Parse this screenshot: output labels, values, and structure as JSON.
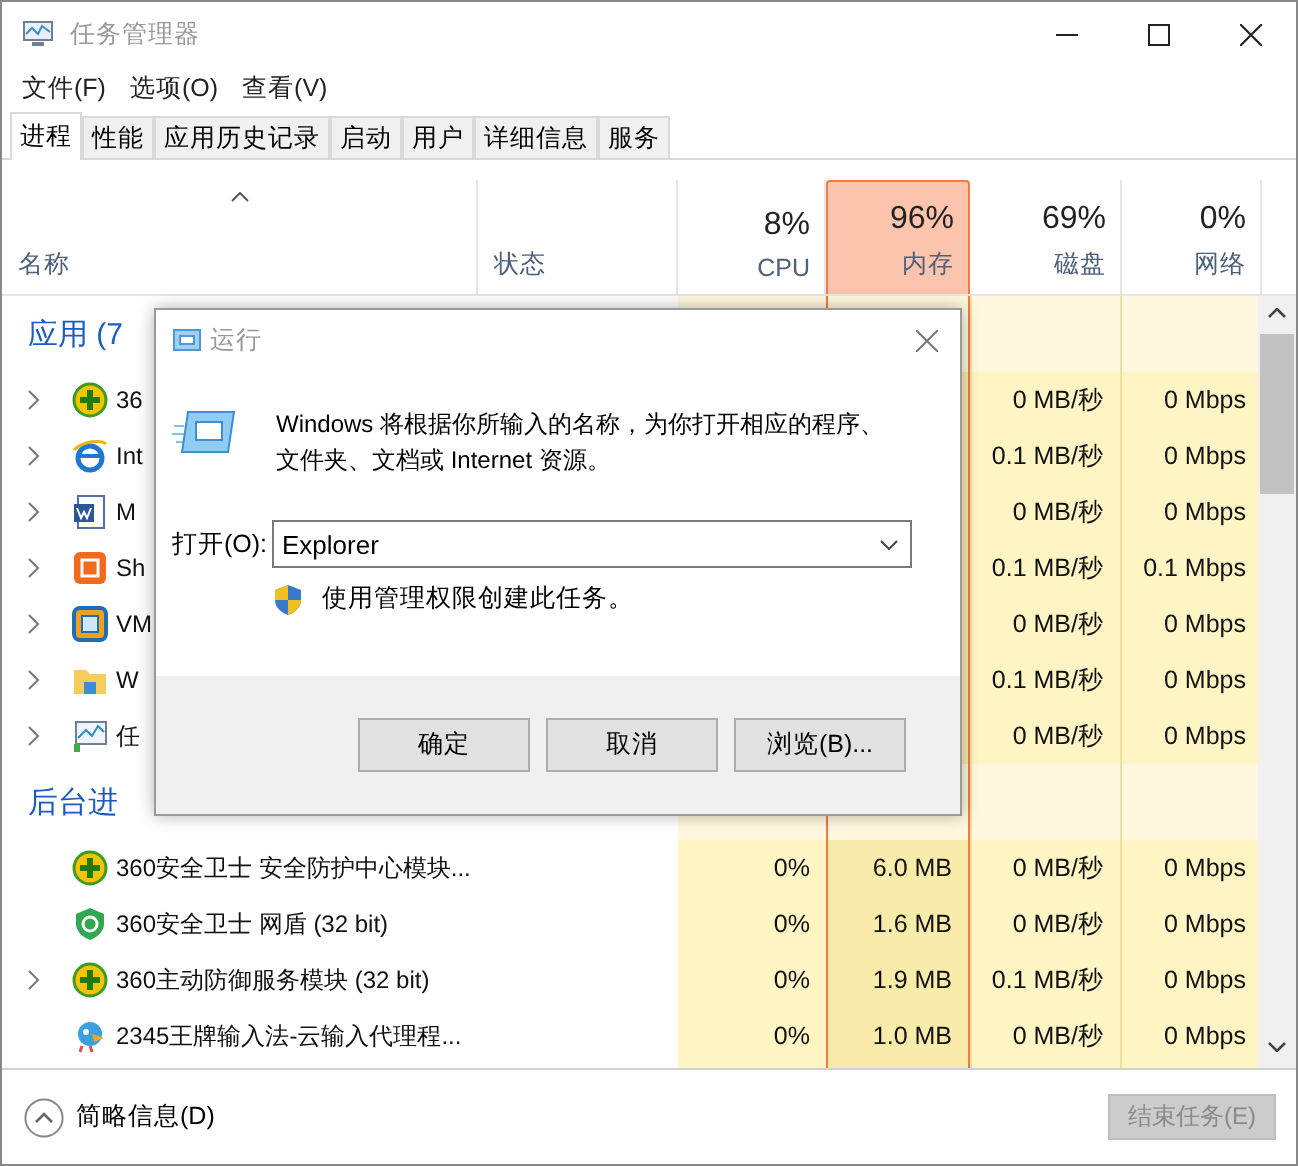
{
  "window": {
    "title": "任务管理器"
  },
  "menu": [
    "文件(F)",
    "选项(O)",
    "查看(V)"
  ],
  "tabs": [
    {
      "label": "进程",
      "selected": true
    },
    {
      "label": "性能",
      "selected": false
    },
    {
      "label": "应用历史记录",
      "selected": false
    },
    {
      "label": "启动",
      "selected": false
    },
    {
      "label": "用户",
      "selected": false
    },
    {
      "label": "详细信息",
      "selected": false
    },
    {
      "label": "服务",
      "selected": false
    }
  ],
  "columns": [
    {
      "kind": "name",
      "label": "名称",
      "sorted": true,
      "highlighted": false
    },
    {
      "kind": "status",
      "label": "状态",
      "sorted": false,
      "highlighted": false
    },
    {
      "kind": "cpu",
      "value": "8%",
      "label": "CPU",
      "sorted": false,
      "highlighted": false
    },
    {
      "kind": "memory",
      "value": "96%",
      "label": "内存",
      "sorted": false,
      "highlighted": true
    },
    {
      "kind": "disk",
      "value": "69%",
      "label": "磁盘",
      "sorted": false,
      "highlighted": false
    },
    {
      "kind": "network",
      "value": "0%",
      "label": "网络",
      "sorted": false,
      "highlighted": false
    }
  ],
  "groups": [
    {
      "title": "应用 (7",
      "rows": [
        {
          "name": "36",
          "expandable": true,
          "disk": "0 MB/秒",
          "network": "0 Mbps"
        },
        {
          "name": "Int",
          "expandable": true,
          "disk": "0.1 MB/秒",
          "network": "0 Mbps"
        },
        {
          "name": "M",
          "expandable": true,
          "disk": "0 MB/秒",
          "network": "0 Mbps"
        },
        {
          "name": "Sh",
          "expandable": true,
          "disk": "0.1 MB/秒",
          "network": "0.1 Mbps"
        },
        {
          "name": "VM",
          "expandable": true,
          "disk": "0 MB/秒",
          "network": "0 Mbps"
        },
        {
          "name": "W",
          "expandable": true,
          "disk": "0.1 MB/秒",
          "network": "0 Mbps"
        },
        {
          "name": "任",
          "expandable": true,
          "disk": "0 MB/秒",
          "network": "0 Mbps"
        }
      ]
    },
    {
      "title": "后台进",
      "rows": [
        {
          "name": "360安全卫士 安全防护中心模块...",
          "expandable": false,
          "cpu": "0%",
          "memory": "6.0 MB",
          "disk": "0 MB/秒",
          "network": "0 Mbps"
        },
        {
          "name": "360安全卫士 网盾 (32 bit)",
          "expandable": false,
          "cpu": "0%",
          "memory": "1.6 MB",
          "disk": "0 MB/秒",
          "network": "0 Mbps"
        },
        {
          "name": "360主动防御服务模块 (32 bit)",
          "expandable": true,
          "cpu": "0%",
          "memory": "1.9 MB",
          "disk": "0.1 MB/秒",
          "network": "0 Mbps"
        },
        {
          "name": "2345王牌输入法-云输入代理程...",
          "expandable": false,
          "cpu": "0%",
          "memory": "1.0 MB",
          "disk": "0 MB/秒",
          "network": "0 Mbps"
        }
      ]
    }
  ],
  "footer": {
    "details": "简略信息(D)",
    "end_task": {
      "label": "结束任务(E)",
      "disabled": true
    }
  },
  "dialog": {
    "title": "运行",
    "description": "Windows 将根据你所输入的名称，为你打开相应的程序、文件夹、文档或 Internet 资源。",
    "open_label": "打开(O):",
    "open_value": "Explorer",
    "admin_note": "使用管理权限创建此任务。",
    "buttons": [
      "确定",
      "取消",
      "浏览(B)..."
    ]
  }
}
